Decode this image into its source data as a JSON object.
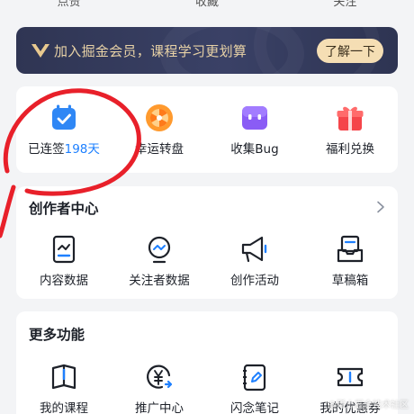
{
  "top_tabs": [
    "点赞",
    "收藏",
    "关注"
  ],
  "vip_banner": {
    "text": "加入掘金会员，课程学习更划算",
    "button": "了解一下",
    "text_color": "#e8d2a6",
    "button_color": "#f5deb4"
  },
  "quick_actions": [
    {
      "prefix": "已连签",
      "count": "198天",
      "icon": "calendar-check-icon"
    },
    {
      "label": "幸运转盘",
      "icon": "lucky-wheel-icon"
    },
    {
      "label": "收集Bug",
      "icon": "bug-robot-icon"
    },
    {
      "label": "福利兑换",
      "icon": "gift-icon"
    }
  ],
  "creator_center": {
    "title": "创作者中心",
    "items": [
      {
        "label": "内容数据",
        "icon": "content-data-icon"
      },
      {
        "label": "关注者数据",
        "icon": "follower-data-icon"
      },
      {
        "label": "创作活动",
        "icon": "megaphone-icon"
      },
      {
        "label": "草稿箱",
        "icon": "drafts-icon"
      }
    ]
  },
  "more_features": {
    "title": "更多功能",
    "items": [
      {
        "label": "我的课程",
        "icon": "book-icon"
      },
      {
        "label": "推广中心",
        "icon": "yen-promo-icon"
      },
      {
        "label": "闪念笔记",
        "icon": "note-pen-icon"
      },
      {
        "label": "我的优惠券",
        "icon": "coupon-icon"
      }
    ]
  },
  "watermark": "@稀土掘金技术社区",
  "accent_color": "#1e80ff",
  "annotation_color": "#e8202a"
}
